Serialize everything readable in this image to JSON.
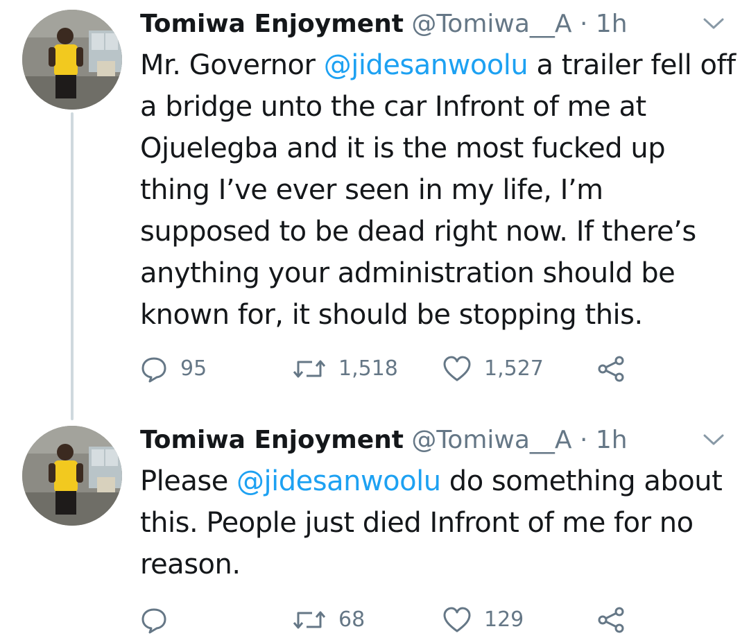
{
  "tweets": [
    {
      "display_name": "Tomiwa Enjoyment",
      "handle": "@Tomiwa__A",
      "separator": "·",
      "time": "1h",
      "text_before": "Mr. Governor ",
      "mention": "@jidesanwoolu",
      "text_after": " a trailer fell off a bridge unto the car Infront of me at Ojuelegba and it is the most fucked up thing I’ve ever seen in my life, I’m supposed to be dead right now. If there’s anything your administration should be known for, it should be stopping this.",
      "replies": "95",
      "retweets": "1,518",
      "likes": "1,527"
    },
    {
      "display_name": "Tomiwa Enjoyment",
      "handle": "@Tomiwa__A",
      "separator": "·",
      "time": "1h",
      "text_before": "Please ",
      "mention": "@jidesanwoolu",
      "text_after": " do something about this. People just died Infront of me for no reason.",
      "replies": "",
      "retweets": "68",
      "likes": "129"
    }
  ],
  "colors": {
    "text": "#14171a",
    "secondary": "#657786",
    "link": "#1da1f2",
    "thread_line": "#cfd9de"
  },
  "icons": [
    "reply-icon",
    "retweet-icon",
    "like-icon",
    "share-icon",
    "chevron-down-icon"
  ]
}
